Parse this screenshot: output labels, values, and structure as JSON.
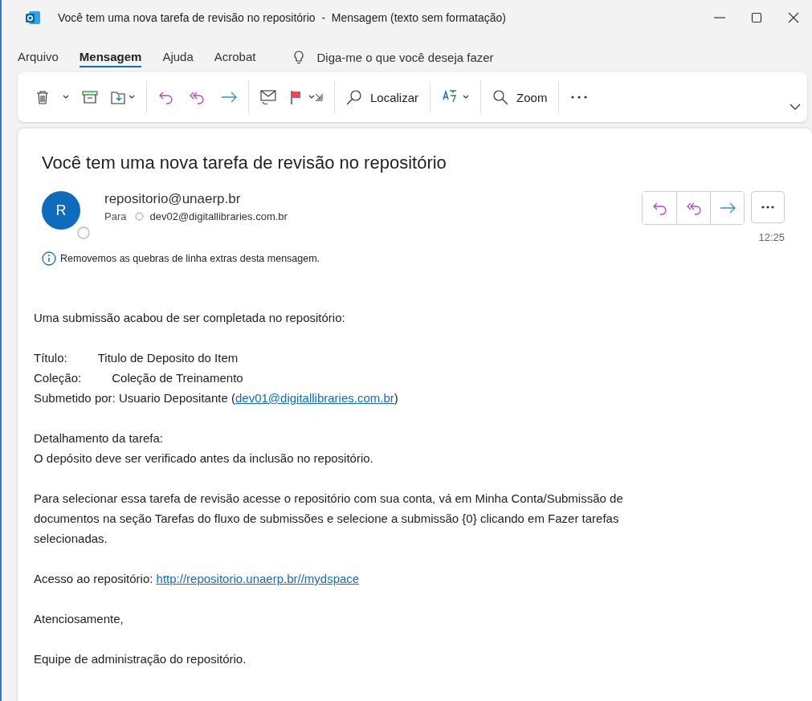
{
  "window": {
    "title": "Você tem uma nova tarefa de revisão no repositório  -  Mensagem (texto sem formatação)"
  },
  "menu_tabs": [
    {
      "label": "Arquivo",
      "selected": false
    },
    {
      "label": "Mensagem",
      "selected": true
    },
    {
      "label": "Ajuda",
      "selected": false
    },
    {
      "label": "Acrobat",
      "selected": false
    }
  ],
  "tell_me": {
    "placeholder": "Diga-me o que você deseja fazer"
  },
  "toolbar": {
    "find_label": "Localizar",
    "zoom_label": "Zoom"
  },
  "message": {
    "subject": "Você tem uma nova tarefa de revisão no repositório",
    "avatar_initial": "R",
    "sender": "repositorio@unaerp.br",
    "to_label": "Para",
    "recipient": "dev02@digitallibraries.com.br",
    "time": "12:25",
    "info": "Removemos as quebras de linha extras desta mensagem.",
    "body": [
      [
        [
          {
            "kind": "text",
            "text": "Uma submissão acabou de ser completada no repositório:"
          }
        ]
      ],
      [
        [
          {
            "kind": "label",
            "text": "Título:"
          },
          {
            "kind": "text",
            "text": "Titulo de Deposito do Item"
          }
        ],
        [
          {
            "kind": "label",
            "text": "Coleção:"
          },
          {
            "kind": "text",
            "text": "Coleção de Treinamento"
          }
        ],
        [
          {
            "kind": "text",
            "text": "Submetido por: Usuario Depositante ("
          },
          {
            "kind": "link",
            "text": "dev01@digitallibraries.com.br"
          },
          {
            "kind": "text",
            "text": ")"
          }
        ]
      ],
      [
        [
          {
            "kind": "text",
            "text": "Detalhamento da tarefa:"
          }
        ],
        [
          {
            "kind": "text",
            "text": "O depósito deve ser verificado antes da inclusão no repositório."
          }
        ]
      ],
      [
        [
          {
            "kind": "text",
            "text": "Para selecionar essa tarefa de revisão acesse o repositório com sua conta, vá em Minha Conta/Submissão de"
          }
        ],
        [
          {
            "kind": "text",
            "text": "documentos na seção Tarefas do fluxo de submissões e selecione a submissão {0} clicando em Fazer tarefas"
          }
        ],
        [
          {
            "kind": "text",
            "text": "selecionadas."
          }
        ]
      ],
      [
        [
          {
            "kind": "text",
            "text": "Acesso ao repositório: "
          },
          {
            "kind": "link",
            "text": "http://repositorio.unaerp.br//mydspace"
          }
        ]
      ],
      [
        [
          {
            "kind": "text",
            "text": "Atenciosamente,"
          }
        ]
      ],
      [
        [
          {
            "kind": "text",
            "text": "Equipe de administração do repositório."
          }
        ]
      ]
    ]
  }
}
